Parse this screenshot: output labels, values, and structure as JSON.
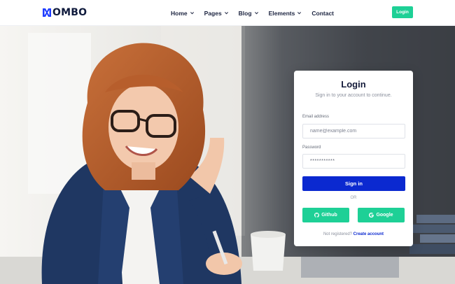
{
  "brand": {
    "name": "OMBO"
  },
  "nav": {
    "items": [
      {
        "label": "Home",
        "dropdown": true
      },
      {
        "label": "Pages",
        "dropdown": true
      },
      {
        "label": "Blog",
        "dropdown": true
      },
      {
        "label": "Elements",
        "dropdown": true
      },
      {
        "label": "Contact",
        "dropdown": false
      }
    ],
    "login_label": "Login"
  },
  "colors": {
    "accent": "#1ed096",
    "primary": "#0b29d0",
    "heading": "#141b3a"
  },
  "login_card": {
    "title": "Login",
    "subtitle": "Sign in to your account to continue.",
    "email": {
      "label": "Email address",
      "placeholder": "name@example.com"
    },
    "password": {
      "label": "Password",
      "value": "***********"
    },
    "signin_label": "Sign in",
    "or_label": "OR",
    "github_label": "Github",
    "google_label": "Google",
    "register_text": "Not registered?",
    "register_link": "Create account"
  }
}
